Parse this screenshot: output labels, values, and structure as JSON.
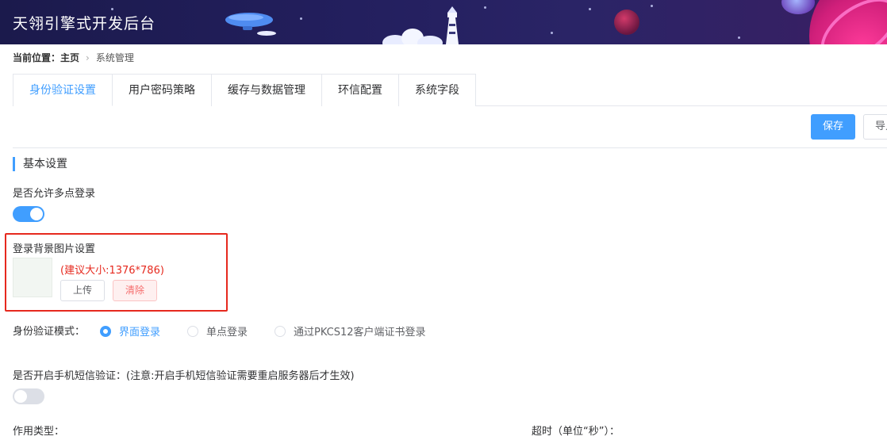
{
  "app": {
    "title": "天翎引擎式开发后台"
  },
  "breadcrumb": {
    "prefix": "当前位置：主页",
    "current": "系统管理"
  },
  "tabs": [
    {
      "label": "身份验证设置",
      "active": true
    },
    {
      "label": "用户密码策略",
      "active": false
    },
    {
      "label": "缓存与数据管理",
      "active": false
    },
    {
      "label": "环信配置",
      "active": false
    },
    {
      "label": "系统字段",
      "active": false
    }
  ],
  "toolbar": {
    "save_label": "保存",
    "import_label": "导入"
  },
  "section": {
    "title": "基本设置"
  },
  "multi_login": {
    "label": "是否允许多点登录",
    "enabled": true
  },
  "background": {
    "label": "登录背景图片设置",
    "hint": "(建议大小:1376*786)",
    "upload_label": "上传",
    "clear_label": "清除"
  },
  "auth_mode": {
    "label": "身份验证模式：",
    "options": [
      {
        "label": "界面登录",
        "checked": true
      },
      {
        "label": "单点登录",
        "checked": false
      },
      {
        "label": "通过PKCS12客户端证书登录",
        "checked": false
      }
    ]
  },
  "sms": {
    "label": "是否开启手机短信验证：(注意:开启手机短信验证需要重启服务器后才生效)",
    "enabled": false
  },
  "effect_type": {
    "label": "作用类型："
  },
  "timeout": {
    "label": "超时（单位“秒”）："
  },
  "colors": {
    "accent": "#409eff",
    "danger": "#e6291e",
    "header_bg": "#1b1a4c"
  }
}
